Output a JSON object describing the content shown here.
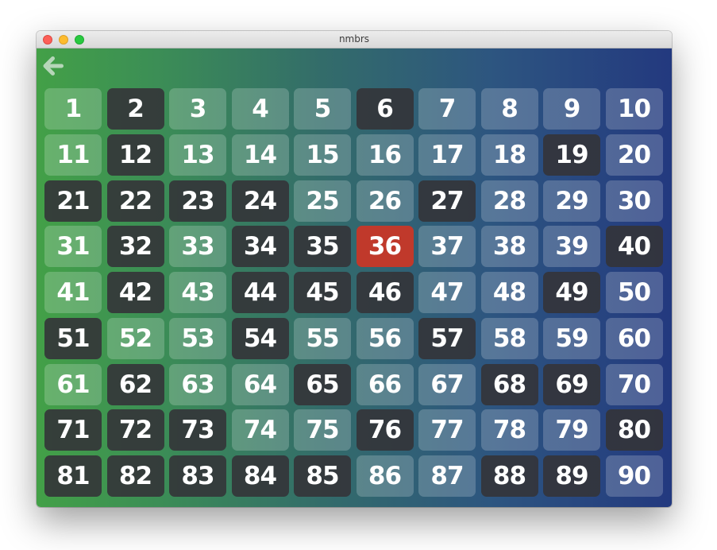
{
  "window": {
    "title": "nmbrs"
  },
  "toolbar": {
    "back_icon": "arrow-left-icon"
  },
  "colors": {
    "gradient_start": "#43a047",
    "gradient_end": "#23397f",
    "selected": "#c0392b",
    "dark_tile": "#343438"
  },
  "grid": {
    "selected": "36",
    "cells": [
      {
        "label": "1",
        "state": "light"
      },
      {
        "label": "2",
        "state": "dark"
      },
      {
        "label": "3",
        "state": "light"
      },
      {
        "label": "4",
        "state": "light"
      },
      {
        "label": "5",
        "state": "light"
      },
      {
        "label": "6",
        "state": "dark"
      },
      {
        "label": "7",
        "state": "light"
      },
      {
        "label": "8",
        "state": "light"
      },
      {
        "label": "9",
        "state": "light"
      },
      {
        "label": "10",
        "state": "light"
      },
      {
        "label": "11",
        "state": "light"
      },
      {
        "label": "12",
        "state": "dark"
      },
      {
        "label": "13",
        "state": "light"
      },
      {
        "label": "14",
        "state": "light"
      },
      {
        "label": "15",
        "state": "light"
      },
      {
        "label": "16",
        "state": "light"
      },
      {
        "label": "17",
        "state": "light"
      },
      {
        "label": "18",
        "state": "light"
      },
      {
        "label": "19",
        "state": "dark"
      },
      {
        "label": "20",
        "state": "light"
      },
      {
        "label": "21",
        "state": "dark"
      },
      {
        "label": "22",
        "state": "dark"
      },
      {
        "label": "23",
        "state": "dark"
      },
      {
        "label": "24",
        "state": "dark"
      },
      {
        "label": "25",
        "state": "light"
      },
      {
        "label": "26",
        "state": "light"
      },
      {
        "label": "27",
        "state": "dark"
      },
      {
        "label": "28",
        "state": "light"
      },
      {
        "label": "29",
        "state": "light"
      },
      {
        "label": "30",
        "state": "light"
      },
      {
        "label": "31",
        "state": "light"
      },
      {
        "label": "32",
        "state": "dark"
      },
      {
        "label": "33",
        "state": "light"
      },
      {
        "label": "34",
        "state": "dark"
      },
      {
        "label": "35",
        "state": "dark"
      },
      {
        "label": "36",
        "state": "selected"
      },
      {
        "label": "37",
        "state": "light"
      },
      {
        "label": "38",
        "state": "light"
      },
      {
        "label": "39",
        "state": "light"
      },
      {
        "label": "40",
        "state": "dark"
      },
      {
        "label": "41",
        "state": "light"
      },
      {
        "label": "42",
        "state": "dark"
      },
      {
        "label": "43",
        "state": "light"
      },
      {
        "label": "44",
        "state": "dark"
      },
      {
        "label": "45",
        "state": "dark"
      },
      {
        "label": "46",
        "state": "dark"
      },
      {
        "label": "47",
        "state": "light"
      },
      {
        "label": "48",
        "state": "light"
      },
      {
        "label": "49",
        "state": "dark"
      },
      {
        "label": "50",
        "state": "light"
      },
      {
        "label": "51",
        "state": "dark"
      },
      {
        "label": "52",
        "state": "light"
      },
      {
        "label": "53",
        "state": "light"
      },
      {
        "label": "54",
        "state": "dark"
      },
      {
        "label": "55",
        "state": "light"
      },
      {
        "label": "56",
        "state": "light"
      },
      {
        "label": "57",
        "state": "dark"
      },
      {
        "label": "58",
        "state": "light"
      },
      {
        "label": "59",
        "state": "light"
      },
      {
        "label": "60",
        "state": "light"
      },
      {
        "label": "61",
        "state": "light"
      },
      {
        "label": "62",
        "state": "dark"
      },
      {
        "label": "63",
        "state": "light"
      },
      {
        "label": "64",
        "state": "light"
      },
      {
        "label": "65",
        "state": "dark"
      },
      {
        "label": "66",
        "state": "light"
      },
      {
        "label": "67",
        "state": "light"
      },
      {
        "label": "68",
        "state": "dark"
      },
      {
        "label": "69",
        "state": "dark"
      },
      {
        "label": "70",
        "state": "light"
      },
      {
        "label": "71",
        "state": "dark"
      },
      {
        "label": "72",
        "state": "dark"
      },
      {
        "label": "73",
        "state": "dark"
      },
      {
        "label": "74",
        "state": "light"
      },
      {
        "label": "75",
        "state": "light"
      },
      {
        "label": "76",
        "state": "dark"
      },
      {
        "label": "77",
        "state": "light"
      },
      {
        "label": "78",
        "state": "light"
      },
      {
        "label": "79",
        "state": "light"
      },
      {
        "label": "80",
        "state": "dark"
      },
      {
        "label": "81",
        "state": "dark"
      },
      {
        "label": "82",
        "state": "dark"
      },
      {
        "label": "83",
        "state": "dark"
      },
      {
        "label": "84",
        "state": "dark"
      },
      {
        "label": "85",
        "state": "dark"
      },
      {
        "label": "86",
        "state": "light"
      },
      {
        "label": "87",
        "state": "light"
      },
      {
        "label": "88",
        "state": "dark"
      },
      {
        "label": "89",
        "state": "dark"
      },
      {
        "label": "90",
        "state": "light"
      }
    ]
  }
}
